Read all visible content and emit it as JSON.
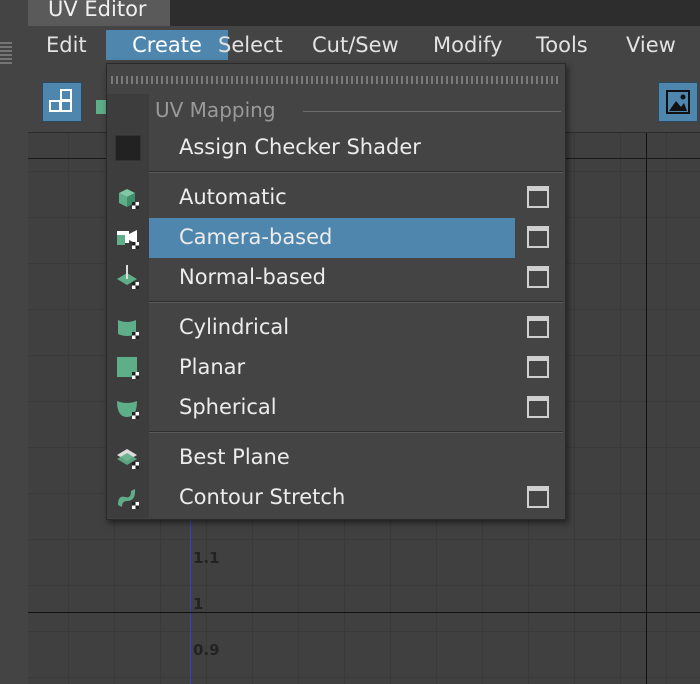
{
  "window": {
    "title": "UV Editor"
  },
  "menubar": {
    "items": [
      {
        "label": "Edit"
      },
      {
        "label": "Create"
      },
      {
        "label": "Select"
      },
      {
        "label": "Cut/Sew"
      },
      {
        "label": "Modify"
      },
      {
        "label": "Tools"
      },
      {
        "label": "View"
      }
    ],
    "active": "Create"
  },
  "dropdown": {
    "section_label": "UV Mapping",
    "items": [
      {
        "label": "Assign Checker Shader",
        "icon": "checker-shader-icon",
        "has_options": false
      },
      {
        "label": "Automatic",
        "icon": "automatic-mapping-icon",
        "has_options": true
      },
      {
        "label": "Camera-based",
        "icon": "camera-mapping-icon",
        "has_options": true,
        "highlighted": true
      },
      {
        "label": "Normal-based",
        "icon": "normal-mapping-icon",
        "has_options": true
      },
      {
        "label": "Cylindrical",
        "icon": "cylindrical-mapping-icon",
        "has_options": true
      },
      {
        "label": "Planar",
        "icon": "planar-mapping-icon",
        "has_options": true
      },
      {
        "label": "Spherical",
        "icon": "spherical-mapping-icon",
        "has_options": true
      },
      {
        "label": "Best Plane",
        "icon": "best-plane-icon",
        "has_options": false
      },
      {
        "label": "Contour Stretch",
        "icon": "contour-stretch-icon",
        "has_options": true
      }
    ]
  },
  "canvas": {
    "ticks": [
      "1.1",
      "1",
      "0.9"
    ]
  },
  "colors": {
    "accent": "#4f86ad",
    "icon_green": "#5fae8a",
    "axis": "#3c3ccf"
  }
}
